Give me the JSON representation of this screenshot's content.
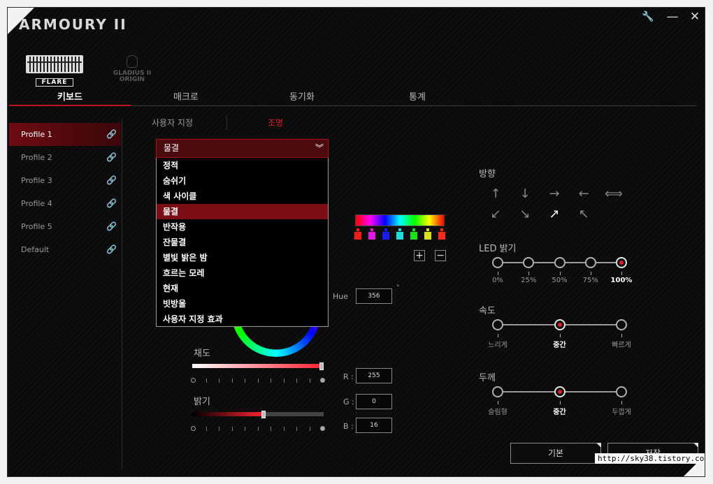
{
  "app": {
    "logo": "ARMOURY II"
  },
  "window": {
    "settings_icon": "wrench-icon",
    "minimize": "—",
    "close": "✕"
  },
  "devices": [
    {
      "label": "FLARE",
      "icon": "keyboard-icon"
    },
    {
      "line1": "GLADIUS II",
      "line2": "ORIGIN",
      "icon": "mouse-icon"
    }
  ],
  "tabs": [
    "키보드",
    "매크로",
    "동기화",
    "통계"
  ],
  "profiles": [
    "Profile 1",
    "Profile 2",
    "Profile 3",
    "Profile 4",
    "Profile 5",
    "Default"
  ],
  "subtabs": {
    "custom": "사용자 지정",
    "lighting": "조명"
  },
  "effect_dropdown": {
    "selected": "물결",
    "chevron": "︾",
    "options": [
      "정적",
      "숨쉬기",
      "색 사이클",
      "물결",
      "반작용",
      "잔물결",
      "별빛 밝은 밤",
      "흐르는 모레",
      "현재",
      "빗방울",
      "사용자 지정 효과"
    ]
  },
  "palette": {
    "colors": [
      "#ff1a1a",
      "#e01ae0",
      "#1a1aff",
      "#1ae0e0",
      "#1ae01a",
      "#e0e01a",
      "#ff2a1a"
    ],
    "add": "+",
    "remove": "−"
  },
  "color": {
    "hue_label": "Hue",
    "hue": "356",
    "degree": "°",
    "saturation_label": "채도",
    "saturation": 1.0,
    "brightness_label": "밝기",
    "brightness": 0.54,
    "r_label": "R :",
    "g_label": "G :",
    "b_label": "B :",
    "r": "255",
    "g": "0",
    "b": "16"
  },
  "direction": {
    "label": "방향",
    "arrows": [
      "↑",
      "↓",
      "→",
      "←",
      "⟺",
      "↙",
      "↘",
      "↗",
      "↖"
    ],
    "selected_index": 7
  },
  "led_brightness": {
    "label": "LED 밝기",
    "options": [
      "0%",
      "25%",
      "50%",
      "75%",
      "100%"
    ],
    "selected_index": 4
  },
  "speed": {
    "label": "속도",
    "options": [
      "느리게",
      "중간",
      "빠르게"
    ],
    "selected_index": 1
  },
  "thickness": {
    "label": "두께",
    "options": [
      "슬림형",
      "중간",
      "두껍게"
    ],
    "selected_index": 1
  },
  "buttons": {
    "default": "기본",
    "save": "저장"
  },
  "watermark": "http://sky38.tistory.com"
}
